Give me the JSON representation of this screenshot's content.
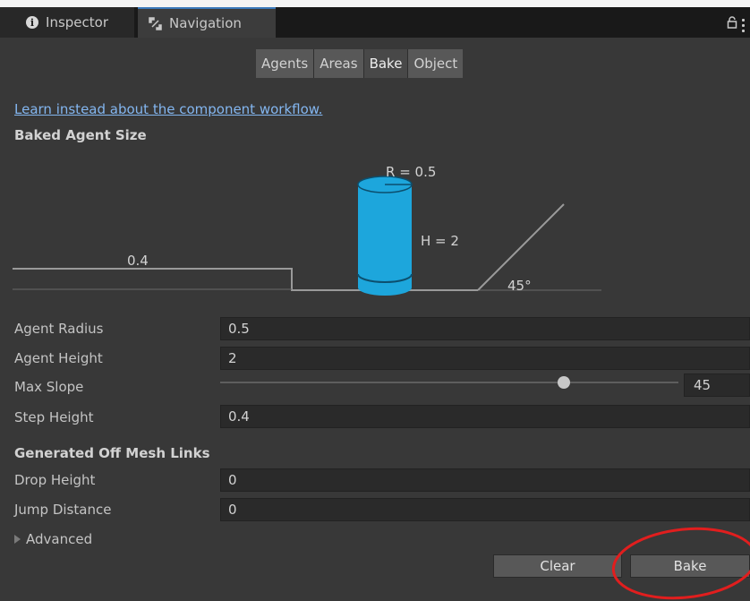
{
  "tabs": [
    {
      "label": "Inspector",
      "icon": "info-icon",
      "active": false
    },
    {
      "label": "Navigation",
      "icon": "navigation-icon",
      "active": true
    }
  ],
  "mode_tabs": [
    {
      "label": "Agents",
      "selected": false
    },
    {
      "label": "Areas",
      "selected": false
    },
    {
      "label": "Bake",
      "selected": true
    },
    {
      "label": "Object",
      "selected": false
    }
  ],
  "link_text": "Learn instead about the component workflow.",
  "baked_agent_size": {
    "title": "Baked Agent Size",
    "radius_label": "R = 0.5",
    "height_label": "H = 2",
    "step_label": "0.4",
    "slope_label": "45°"
  },
  "fields": {
    "agent_radius": {
      "label": "Agent Radius",
      "value": "0.5"
    },
    "agent_height": {
      "label": "Agent Height",
      "value": "2"
    },
    "max_slope": {
      "label": "Max Slope",
      "value": "45",
      "slider_fraction": 0.75
    },
    "step_height": {
      "label": "Step Height",
      "value": "0.4"
    }
  },
  "off_mesh": {
    "title": "Generated Off Mesh Links",
    "drop_height": {
      "label": "Drop Height",
      "value": "0"
    },
    "jump_distance": {
      "label": "Jump Distance",
      "value": "0"
    }
  },
  "advanced_label": "Advanced",
  "buttons": {
    "clear": "Clear",
    "bake": "Bake"
  },
  "colors": {
    "accent": "#3a79bb",
    "link": "#83b6f0",
    "agent": "#1da6dc",
    "annotation": "#e11e1e"
  }
}
